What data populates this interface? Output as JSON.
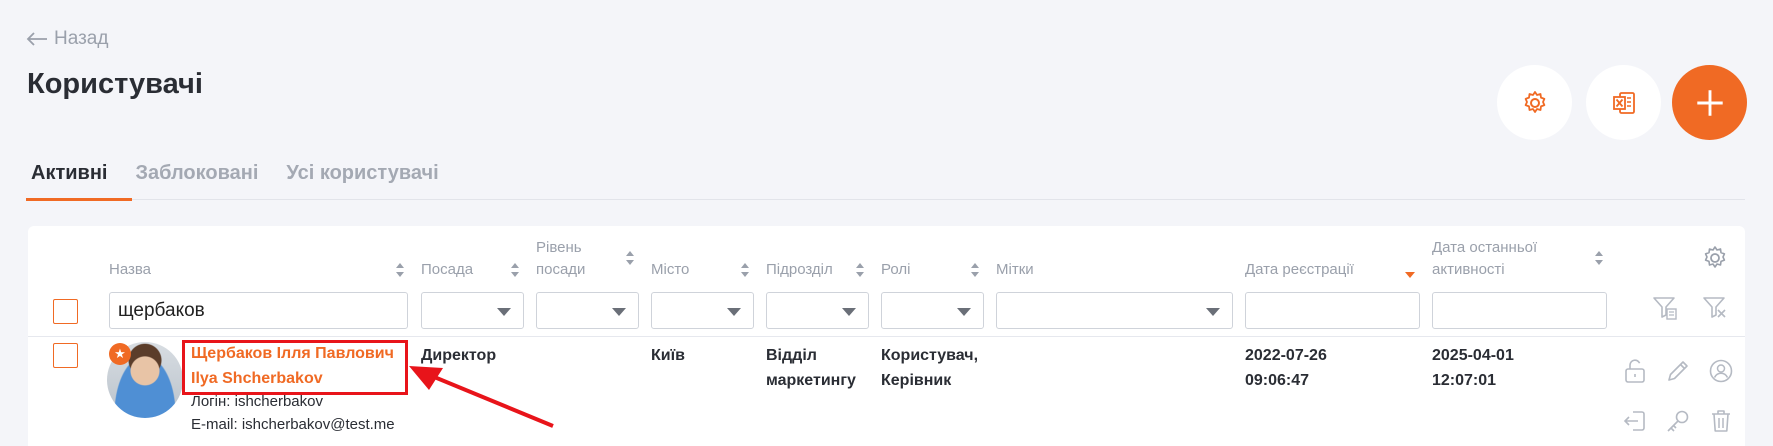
{
  "nav": {
    "back_label": "Назад"
  },
  "page": {
    "title": "Користувачі"
  },
  "actions": {
    "settings": "gear-icon",
    "export": "excel-icon",
    "add": "plus-icon"
  },
  "tabs": [
    {
      "label": "Активні",
      "active": true
    },
    {
      "label": "Заблоковані",
      "active": false
    },
    {
      "label": "Усі користувачі",
      "active": false
    }
  ],
  "columns": {
    "name": "Назва",
    "position": "Посада",
    "level_1": "Рівень",
    "level_2": "посади",
    "city": "Місто",
    "department": "Підрозділ",
    "roles": "Ролі",
    "tags": "Мітки",
    "reg_date": "Дата реєстрації",
    "last_1": "Дата останньої",
    "last_2": "активності"
  },
  "filters": {
    "name_value": "щербаков"
  },
  "row": {
    "name_uk": "Щербаков Ілля Павлович",
    "name_en": "Ilya Shcherbakov",
    "login": "Логін: ishcherbakov",
    "email": "E-mail: ishcherbakov@test.me",
    "position": "Директор",
    "city": "Київ",
    "department_1": "Відділ",
    "department_2": "маркетингу",
    "roles_1": "Користувач,",
    "roles_2": "Керівник",
    "reg_date": "2022-07-26",
    "reg_time": "09:06:47",
    "last_date": "2025-04-01",
    "last_time": "12:07:01"
  },
  "colors": {
    "accent": "#f06a24",
    "highlight": "#e8141a",
    "muted": "#9aa0ab"
  }
}
